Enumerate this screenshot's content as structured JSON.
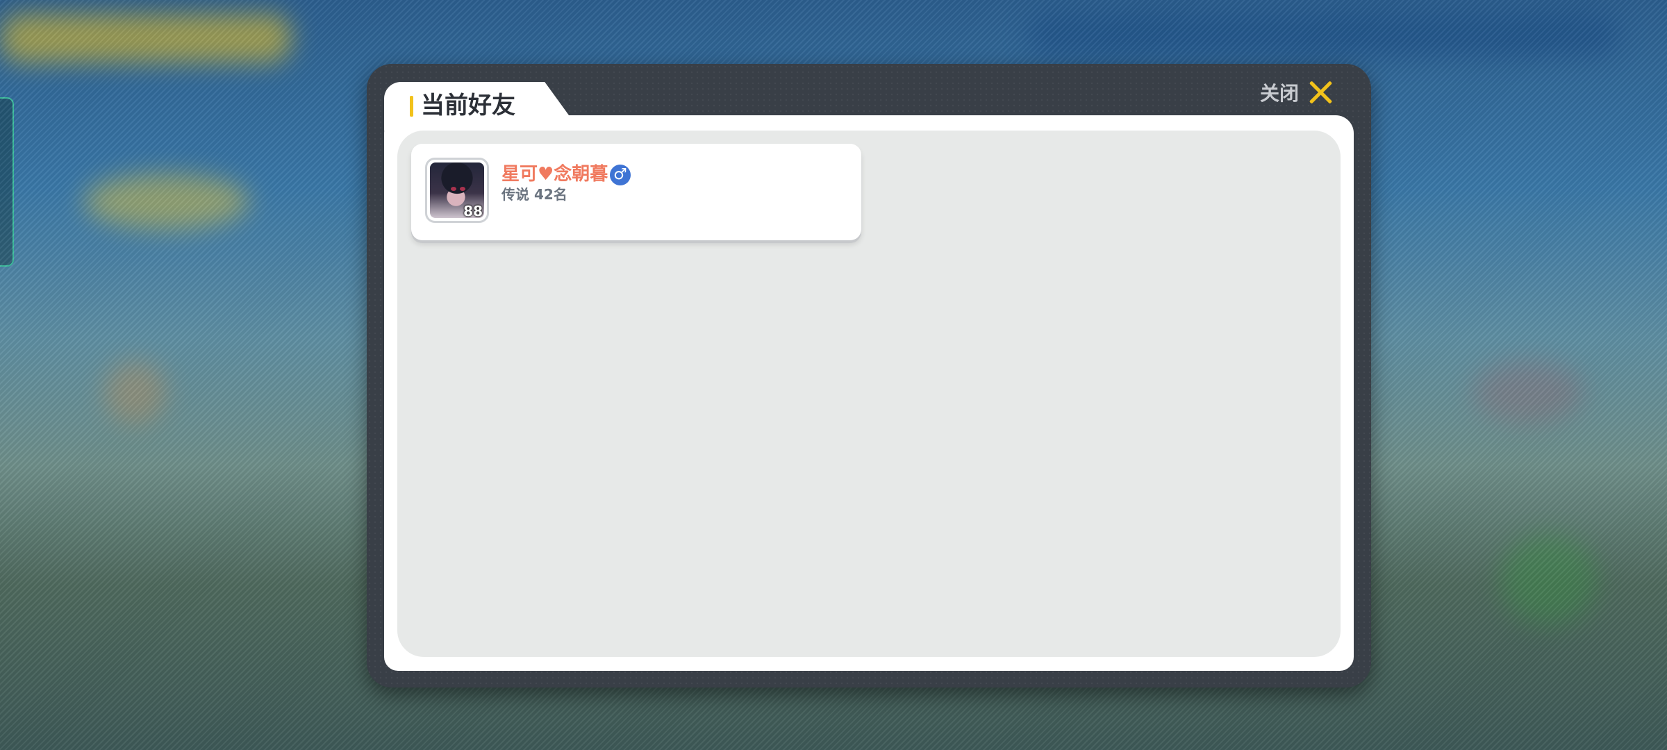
{
  "dialog": {
    "tab_title": "当前好友",
    "close_label": "关闭"
  },
  "friends": [
    {
      "name": "星可♥念朝暮",
      "gender_icon": "male-icon",
      "gender_symbol": "♂",
      "rank": "传说 42名",
      "level": "88"
    }
  ],
  "colors": {
    "accent": "#f2c21b",
    "name": "#f07a5f",
    "gender_male": "#3f74d4"
  }
}
